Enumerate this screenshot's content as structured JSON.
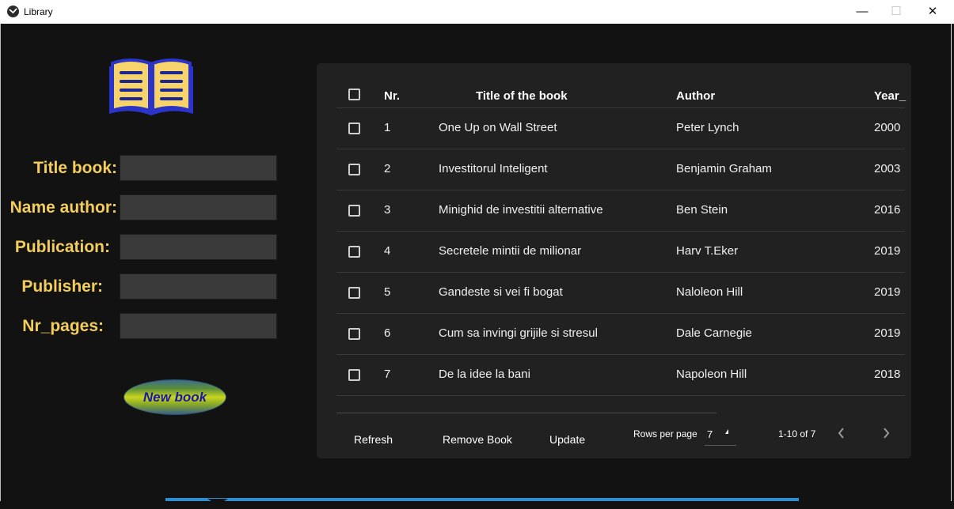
{
  "window": {
    "title": "Library",
    "minimize": "—",
    "maximize": "☐",
    "close": "✕"
  },
  "colors": {
    "label": "#f3ce5c",
    "accent_button_text": "#1a16a8",
    "panel": "#212121",
    "background": "#121212"
  },
  "form": {
    "fields": [
      {
        "label": "Title book:",
        "value": ""
      },
      {
        "label": "Name author:",
        "value": ""
      },
      {
        "label": "Publication:",
        "value": ""
      },
      {
        "label": "Publisher:",
        "value": ""
      },
      {
        "label": "Nr_pages:",
        "value": ""
      }
    ],
    "new_book_button": "New book"
  },
  "table": {
    "headers": {
      "nr": "Nr.",
      "title": "Title of the book",
      "author": "Author",
      "year": "Year_"
    },
    "rows": [
      {
        "nr": "1",
        "title": "One Up on Wall Street",
        "author": "Peter Lynch",
        "year": "2000"
      },
      {
        "nr": "2",
        "title": "Investitorul Inteligent",
        "author": "Benjamin Graham",
        "year": "2003"
      },
      {
        "nr": "3",
        "title": "Minighid de investitii alternative",
        "author": "Ben Stein",
        "year": "2016"
      },
      {
        "nr": "4",
        "title": "Secretele mintii de milionar",
        "author": "Harv T.Eker",
        "year": "2019"
      },
      {
        "nr": "5",
        "title": "Gandeste si vei fi bogat",
        "author": "Naloleon Hill",
        "year": "2019"
      },
      {
        "nr": "6",
        "title": "Cum sa invingi grijile si stresul",
        "author": "Dale Carnegie",
        "year": "2019"
      },
      {
        "nr": "7",
        "title": "De la idee la bani",
        "author": "Napoleon Hill",
        "year": "2018"
      }
    ]
  },
  "footer": {
    "refresh": "Refresh",
    "remove": "Remove Book",
    "update": "Update",
    "rows_per_page_label": "Rows per page",
    "rows_per_page_value": "7",
    "range": "1-10 of 7"
  },
  "icons": {
    "logo": "open-book-icon",
    "prev": "chevron-left-icon",
    "next": "chevron-right-icon"
  }
}
